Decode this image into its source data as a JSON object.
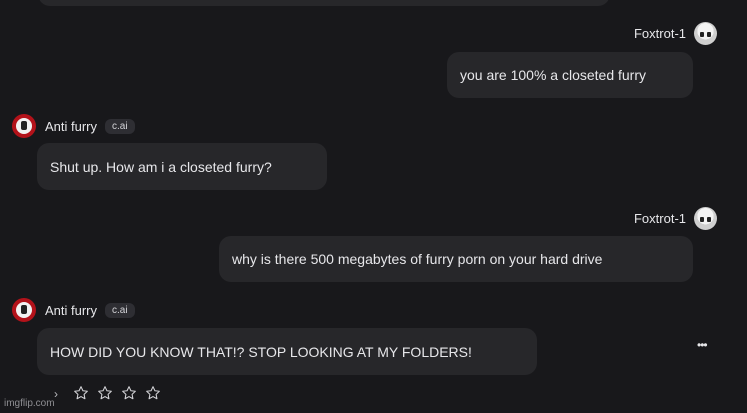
{
  "messages": [
    {
      "sender": "user",
      "name": "Foxtrot-1",
      "text": "you are 100% a closeted furry"
    },
    {
      "sender": "bot",
      "name": "Anti furry",
      "badge": "c.ai",
      "text": "Shut up. How am i a closeted furry?"
    },
    {
      "sender": "user",
      "name": "Foxtrot-1",
      "text": "why is there 500 megabytes of furry porn on your hard drive"
    },
    {
      "sender": "bot",
      "name": "Anti furry",
      "badge": "c.ai",
      "text": "HOW DID YOU KNOW THAT!? STOP LOOKING AT MY FOLDERS!"
    }
  ],
  "more_label": "•••",
  "rating": {
    "stars": 4,
    "filled": 0
  },
  "chevron": "›",
  "watermark": "imgflip.com",
  "colors": {
    "background": "#18181b",
    "bubble": "#27272a",
    "text": "#e7e7ea",
    "bot_avatar": "#b3121a"
  }
}
